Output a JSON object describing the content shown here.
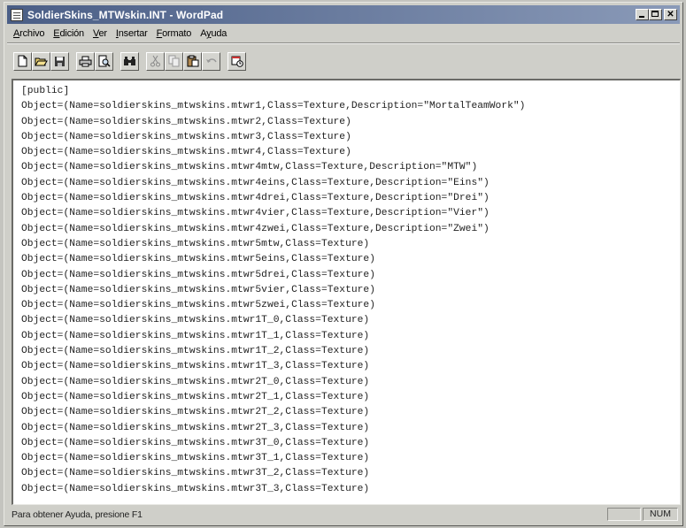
{
  "window": {
    "title": "SoldierSkins_MTWskin.INT - WordPad"
  },
  "menu": {
    "items": [
      {
        "label": "Archivo",
        "accel": "A",
        "rest": "rchivo"
      },
      {
        "label": "Edición",
        "accel": "E",
        "rest": "dición"
      },
      {
        "label": "Ver",
        "accel": "V",
        "rest": "er"
      },
      {
        "label": "Insertar",
        "accel": "I",
        "rest": "nsertar"
      },
      {
        "label": "Formato",
        "accel": "F",
        "rest": "ormato"
      },
      {
        "label": "Ayuda",
        "accel": "y",
        "pre": "A",
        "rest": "uda"
      }
    ]
  },
  "toolbar": {
    "buttons": [
      {
        "icon": "new-document-icon"
      },
      {
        "icon": "open-folder-icon"
      },
      {
        "icon": "save-disk-icon"
      },
      {
        "icon": "print-icon"
      },
      {
        "icon": "print-preview-icon"
      },
      {
        "icon": "find-binoculars-icon"
      },
      {
        "icon": "cut-scissors-icon"
      },
      {
        "icon": "copy-icon"
      },
      {
        "icon": "paste-icon"
      },
      {
        "icon": "undo-icon"
      },
      {
        "icon": "insert-datetime-icon"
      }
    ]
  },
  "document": {
    "lines": [
      "[public]",
      "Object=(Name=soldierskins_mtwskins.mtwr1,Class=Texture,Description=\"MortalTeamWork\")",
      "Object=(Name=soldierskins_mtwskins.mtwr2,Class=Texture)",
      "Object=(Name=soldierskins_mtwskins.mtwr3,Class=Texture)",
      "Object=(Name=soldierskins_mtwskins.mtwr4,Class=Texture)",
      "Object=(Name=soldierskins_mtwskins.mtwr4mtw,Class=Texture,Description=\"MTW\")",
      "Object=(Name=soldierskins_mtwskins.mtwr4eins,Class=Texture,Description=\"Eins\")",
      "Object=(Name=soldierskins_mtwskins.mtwr4drei,Class=Texture,Description=\"Drei\")",
      "Object=(Name=soldierskins_mtwskins.mtwr4vier,Class=Texture,Description=\"Vier\")",
      "Object=(Name=soldierskins_mtwskins.mtwr4zwei,Class=Texture,Description=\"Zwei\")",
      "Object=(Name=soldierskins_mtwskins.mtwr5mtw,Class=Texture)",
      "Object=(Name=soldierskins_mtwskins.mtwr5eins,Class=Texture)",
      "Object=(Name=soldierskins_mtwskins.mtwr5drei,Class=Texture)",
      "Object=(Name=soldierskins_mtwskins.mtwr5vier,Class=Texture)",
      "Object=(Name=soldierskins_mtwskins.mtwr5zwei,Class=Texture)",
      "Object=(Name=soldierskins_mtwskins.mtwr1T_0,Class=Texture)",
      "Object=(Name=soldierskins_mtwskins.mtwr1T_1,Class=Texture)",
      "Object=(Name=soldierskins_mtwskins.mtwr1T_2,Class=Texture)",
      "Object=(Name=soldierskins_mtwskins.mtwr1T_3,Class=Texture)",
      "Object=(Name=soldierskins_mtwskins.mtwr2T_0,Class=Texture)",
      "Object=(Name=soldierskins_mtwskins.mtwr2T_1,Class=Texture)",
      "Object=(Name=soldierskins_mtwskins.mtwr2T_2,Class=Texture)",
      "Object=(Name=soldierskins_mtwskins.mtwr2T_3,Class=Texture)",
      "Object=(Name=soldierskins_mtwskins.mtwr3T_0,Class=Texture)",
      "Object=(Name=soldierskins_mtwskins.mtwr3T_1,Class=Texture)",
      "Object=(Name=soldierskins_mtwskins.mtwr3T_2,Class=Texture)",
      "Object=(Name=soldierskins_mtwskins.mtwr3T_3,Class=Texture)"
    ]
  },
  "statusbar": {
    "help_text": "Para obtener Ayuda, presione F1",
    "num_indicator": "NUM"
  },
  "colors": {
    "titlebar_start": "#4a5e86",
    "titlebar_end": "#8a9ab8",
    "chrome": "#cfcfc9",
    "editor_bg": "#ffffff",
    "text": "#222222"
  }
}
